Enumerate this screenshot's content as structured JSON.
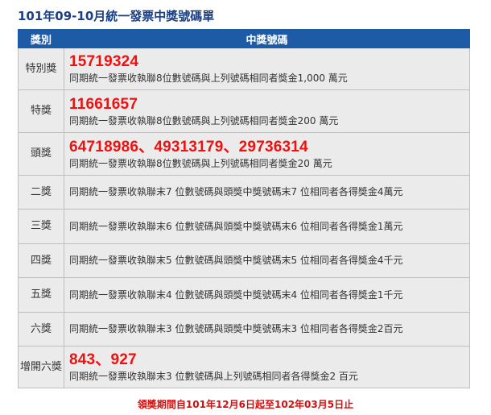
{
  "title": "101年09-10月統一發票中獎號碼單",
  "table": {
    "headers": {
      "category": "獎別",
      "numbers": "中獎號碼"
    },
    "rows": [
      {
        "category": "特別獎",
        "numbers": "15719324",
        "desc": "同期統一發票收執聯8位數號碼與上列號碼相同者獎金1,000 萬元"
      },
      {
        "category": "特獎",
        "numbers": "11661657",
        "desc": "同期統一發票收執聯8位數號碼與上列號碼相同者獎金200 萬元"
      },
      {
        "category": "頭獎",
        "numbers": "64718986、49313179、29736314",
        "desc": "同期統一發票收執聯8位數號碼與上列號碼相同者獎金20 萬元"
      },
      {
        "category": "二獎",
        "numbers": "",
        "desc": "同期統一發票收執聯末7 位數號碼與頭獎中獎號碼末7 位相同者各得獎金4萬元"
      },
      {
        "category": "三獎",
        "numbers": "",
        "desc": "同期統一發票收執聯末6 位數號碼與頭獎中獎號碼末6 位相同者各得獎金1萬元"
      },
      {
        "category": "四獎",
        "numbers": "",
        "desc": "同期統一發票收執聯末5 位數號碼與頭獎中獎號碼末5 位相同者各得獎金4千元"
      },
      {
        "category": "五獎",
        "numbers": "",
        "desc": "同期統一發票收執聯末4 位數號碼與頭獎中獎號碼末4 位相同者各得獎金1千元"
      },
      {
        "category": "六獎",
        "numbers": "",
        "desc": "同期統一發票收執聯末3 位數號碼與頭獎中獎號碼末3 位相同者各得獎金2百元"
      },
      {
        "category": "增開六獎",
        "numbers": "843、927",
        "desc": "同期統一發票收執聯末3 位數號碼與上列號碼相同者各得獎金2 百元"
      }
    ]
  },
  "footer": "領獎期間自101年12月6日起至102年03月5日止",
  "colors": {
    "header_bg": "#1e5ba6",
    "title": "#1a3f85",
    "numbers": "#ee1111",
    "footer": "#d01010",
    "row_bg": "#ebebeb"
  }
}
